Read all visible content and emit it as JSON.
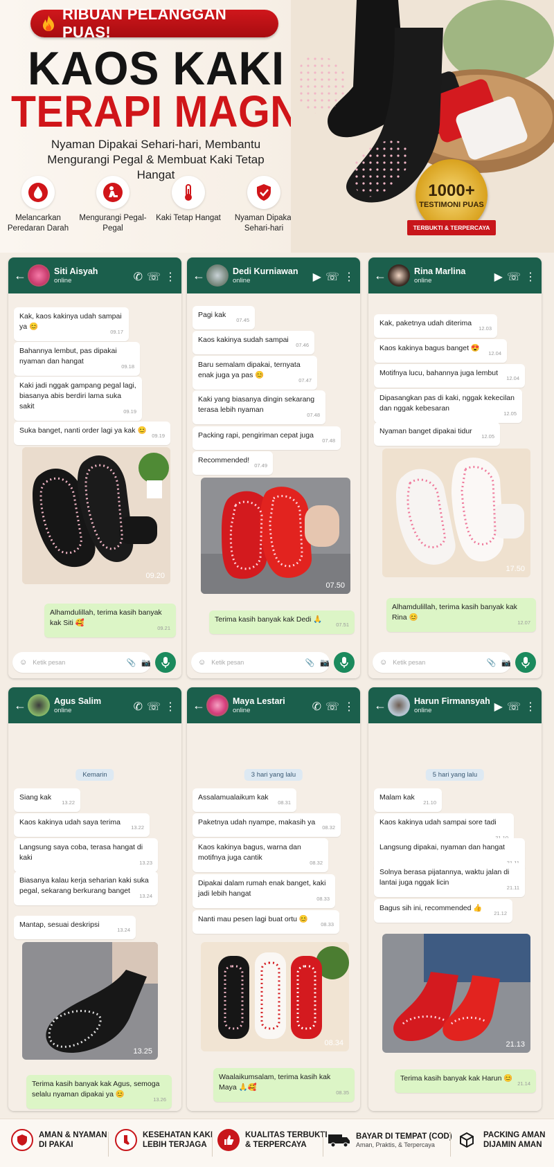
{
  "hero": {
    "badge": "RIBUAN PELANGGAN PUAS!",
    "title_line1": "KAOS KAKI",
    "title_line2": "TERAPI MAGNETIK",
    "subtitle": "Nyaman Dipakai Sehari-hari, Membantu Mengurangi Pegal & Membuat Kaki Tetap Hangat",
    "features": [
      {
        "label": "Melancarkan Peredaran Darah",
        "icon": "blood-drop-icon"
      },
      {
        "label": "Mengurangi Pegal-Pegal",
        "icon": "massage-icon"
      },
      {
        "label": "Kaki Tetap Hangat",
        "icon": "thermometer-icon"
      },
      {
        "label": "Nyaman Dipakai Sehari-hari",
        "icon": "shield-check-icon"
      }
    ],
    "seal_number": "1000+",
    "seal_text": "TESTIMONI PUAS",
    "seal_ribbon": "TERBUKTI & TERPERCAYA"
  },
  "common": {
    "placeholder": "Ketik pesan",
    "status": "online"
  },
  "chats": [
    {
      "name": "Siti Aisyah",
      "messages": [
        {
          "text": "Kak, kaos kakinya udah sampai ya 😊",
          "time": "09.17"
        },
        {
          "text": "Bahannya lembut, pas dipakai nyaman dan hangat",
          "time": "09.18"
        },
        {
          "text": "Kaki jadi nggak gampang pegal lagi, biasanya abis berdiri lama suka sakit",
          "time": "09.19"
        },
        {
          "text": "Suka banget, nanti order lagi ya kak 😊",
          "time": "09.19"
        }
      ],
      "photo_time": "09.20",
      "reply": {
        "text": "Alhamdulillah, terima kasih banyak kak Siti 🥰",
        "time": "09.21"
      }
    },
    {
      "name": "Dedi Kurniawan",
      "messages": [
        {
          "text": "Pagi kak",
          "time": "07.45"
        },
        {
          "text": "Kaos kakinya sudah sampai",
          "time": "07.46"
        },
        {
          "text": "Baru semalam dipakai, ternyata enak juga ya pas 😊",
          "time": "07.47"
        },
        {
          "text": "Kaki yang biasanya dingin sekarang terasa lebih nyaman",
          "time": "07.48"
        },
        {
          "text": "Packing rapi, pengiriman cepat juga",
          "time": "07.48"
        },
        {
          "text": "Recommended!",
          "time": "07.49"
        }
      ],
      "photo_time": "07.50",
      "reply": {
        "text": "Terima kasih banyak kak Dedi 🙏",
        "time": "07.51"
      }
    },
    {
      "name": "Rina Marlina",
      "messages": [
        {
          "text": "Kak, paketnya udah diterima",
          "time": "12.03"
        },
        {
          "text": "Kaos kakinya bagus banget 😍",
          "time": "12.04"
        },
        {
          "text": "Motifnya lucu, bahannya juga lembut",
          "time": "12.04"
        },
        {
          "text": "Dipasangkan pas di kaki, nggak kekecilan dan nggak kebesaran",
          "time": "12.05"
        },
        {
          "text": "Nyaman banget dipakai tidur",
          "time": "12.05"
        }
      ],
      "photo_time": "17.50",
      "reply": {
        "text": "Alhamdulillah, terima kasih banyak kak Rina 😊",
        "time": "12.07"
      }
    },
    {
      "name": "Agus Salim",
      "date": "Kemarin",
      "messages": [
        {
          "text": "Siang kak",
          "time": "13.22"
        },
        {
          "text": "Kaos kakinya udah saya terima",
          "time": "13.22"
        },
        {
          "text": "Langsung saya coba, terasa hangat di kaki",
          "time": "13.23"
        },
        {
          "text": "Biasanya kalau kerja seharian kaki suka pegal, sekarang berkurang banget",
          "time": "13.24"
        },
        {
          "text": "Mantap, sesuai deskripsi",
          "time": "13.24"
        }
      ],
      "photo_time": "13.25",
      "reply": {
        "text": "Terima kasih banyak kak Agus, semoga selalu nyaman dipakai ya 😊",
        "time": "13.26"
      }
    },
    {
      "name": "Maya Lestari",
      "date": "3 hari yang lalu",
      "messages": [
        {
          "text": "Assalamualaikum kak",
          "time": "08.31"
        },
        {
          "text": "Paketnya udah nyampe, makasih ya",
          "time": "08.32"
        },
        {
          "text": "Kaos kakinya bagus, warna dan motifnya juga cantik",
          "time": "08.32"
        },
        {
          "text": "Dipakai dalam rumah enak banget, kaki jadi lebih hangat",
          "time": "08.33"
        },
        {
          "text": "Nanti mau pesen lagi buat ortu 😊",
          "time": "08.33"
        }
      ],
      "photo_time": "08.34",
      "reply": {
        "text": "Waalaikumsalam, terima kasih kak Maya 🙏🥰",
        "time": "08.35"
      }
    },
    {
      "name": "Harun Firmansyah",
      "date": "5 hari yang lalu",
      "messages": [
        {
          "text": "Malam kak",
          "time": "21.10"
        },
        {
          "text": "Kaos kakinya udah sampai sore tadi",
          "time": "21.10"
        },
        {
          "text": "Langsung dipakai, nyaman dan hangat",
          "time": "21.11"
        },
        {
          "text": "Solnya berasa pijatannya, waktu jalan di lantai juga nggak licin",
          "time": "21.11"
        },
        {
          "text": "Bagus sih ini, recommended 👍",
          "time": "21.12"
        }
      ],
      "photo_time": "21.13",
      "reply": {
        "text": "Terima kasih banyak kak Harun 😊",
        "time": "21.14"
      }
    }
  ],
  "footer": [
    {
      "title": "AMAN & NYAMAN DI PAKAI",
      "sub": "",
      "icon": "shield-icon"
    },
    {
      "title": "KESEHATAN KAKI LEBIH TERJAGA",
      "sub": "",
      "icon": "foot-icon"
    },
    {
      "title": "KUALITAS TERBUKTI & TERPERCAYA",
      "sub": "",
      "icon": "thumbs-up-icon"
    },
    {
      "title": "BAYAR DI TEMPAT (COD)",
      "sub": "Aman, Praktis, & Terpercaya",
      "icon": "truck-icon"
    },
    {
      "title": "PACKING AMAN DIJAMIN AMAN",
      "sub": "",
      "icon": "box-icon"
    }
  ],
  "colors": {
    "header_green": "#1b5f4c",
    "brand_red": "#d01519",
    "outgoing_bubble": "#dcf5c6"
  }
}
